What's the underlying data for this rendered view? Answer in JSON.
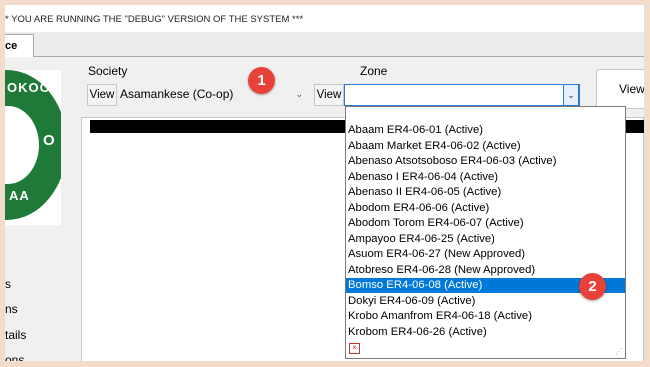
{
  "window": {
    "debug_banner": "* YOU ARE RUNNING THE \"DEBUG\" VERSION OF THE SYSTEM ***"
  },
  "tab": {
    "label": "ce"
  },
  "logo": {
    "top_text": "OKOO",
    "bottom_text": "AA",
    "mid_text": "O",
    "color": "#1f7a3a"
  },
  "nav": {
    "items": [
      "s",
      "ns",
      "tails",
      "ons"
    ]
  },
  "society": {
    "label": "Society",
    "view_label": "View",
    "selected": "Asamankese (Co-op)"
  },
  "zone": {
    "label": "Zone",
    "view_label": "View",
    "value": ""
  },
  "view_button": {
    "label": "View"
  },
  "dropdown": {
    "options": [
      "Abaam ER4-06-01 (Active)",
      "Abaam Market ER4-06-02 (Active)",
      "Abenaso Atsotsoboso ER4-06-03 (Active)",
      "Abenaso I ER4-06-04 (Active)",
      "Abenaso II ER4-06-05 (Active)",
      "Abodom ER4-06-06 (Active)",
      "Abodom Torom ER4-06-07 (Active)",
      "Ampayoo ER4-06-25 (Active)",
      "Asuom ER4-06-27 (New Approved)",
      "Atobreso ER4-06-28 (New Approved)",
      "Bomso ER4-06-08 (Active)",
      "Dokyi ER4-06-09 (Active)",
      "Krobo Amanfrom ER4-06-18 (Active)",
      "Krobom ER4-06-26 (Active)"
    ],
    "selected_index": 10
  },
  "annotations": {
    "badge1": "1",
    "badge2": "2",
    "color": "#e8413a"
  }
}
